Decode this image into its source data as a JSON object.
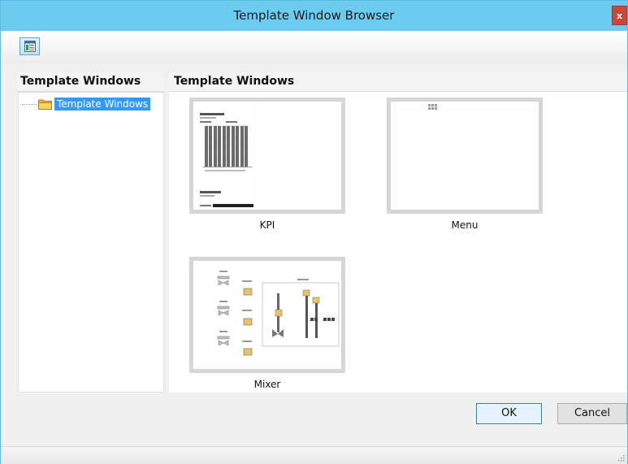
{
  "window": {
    "title": "Template Window Browser",
    "close_label": "x"
  },
  "toolbar": {
    "view_button_icon": "window-layout-icon"
  },
  "left_panel": {
    "header": "Template Windows",
    "tree": [
      {
        "label": "Template Windows",
        "selected": true,
        "icon": "folder-icon"
      }
    ]
  },
  "right_panel": {
    "header": "Template Windows",
    "templates": [
      {
        "label": "KPI"
      },
      {
        "label": "Menu"
      },
      {
        "label": "Mixer"
      }
    ]
  },
  "buttons": {
    "ok": "OK",
    "cancel": "Cancel"
  },
  "colors": {
    "titlebar": "#6ccbef",
    "close": "#c9473b",
    "selection": "#3399ff"
  }
}
